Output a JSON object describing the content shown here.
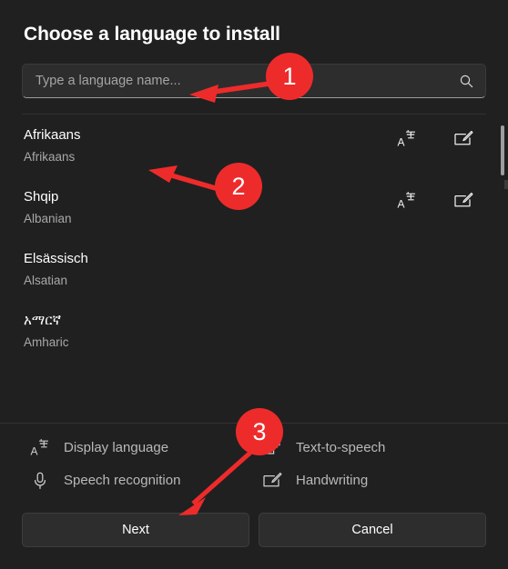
{
  "dialog": {
    "title": "Choose a language to install"
  },
  "search": {
    "placeholder": "Type a language name...",
    "value": "",
    "icon": "search-icon"
  },
  "languages": [
    {
      "native": "Afrikaans",
      "english": "Afrikaans",
      "icons": [
        "display-language-icon",
        "handwriting-icon"
      ]
    },
    {
      "native": "Shqip",
      "english": "Albanian",
      "icons": [
        "display-language-icon",
        "handwriting-icon"
      ]
    },
    {
      "native": "Elsässisch",
      "english": "Alsatian",
      "icons": [
        "display-language-icon",
        "handwriting-icon"
      ]
    },
    {
      "native": "አማርኛ",
      "english": "Amharic",
      "icons": [
        "display-language-icon",
        "handwriting-icon"
      ]
    }
  ],
  "legend": [
    {
      "label": "Display language",
      "icon": "display-language-icon"
    },
    {
      "label": "Text-to-speech",
      "icon": "text-to-speech-icon"
    },
    {
      "label": "Speech recognition",
      "icon": "microphone-icon"
    },
    {
      "label": "Handwriting",
      "icon": "handwriting-icon"
    }
  ],
  "footer": {
    "next_label": "Next",
    "cancel_label": "Cancel"
  },
  "annotations": {
    "color": "#ee2b2b",
    "badges": [
      {
        "number": "1"
      },
      {
        "number": "2"
      },
      {
        "number": "3"
      }
    ]
  },
  "colors": {
    "dialog_background": "#202020",
    "page_background": "#1d1d1d",
    "field_background": "#2d2d2d",
    "button_background": "#2d2d2d",
    "primary_text": "#ffffff",
    "secondary_text": "#a8a8a8",
    "annotation_red": "#ee2b2b"
  }
}
